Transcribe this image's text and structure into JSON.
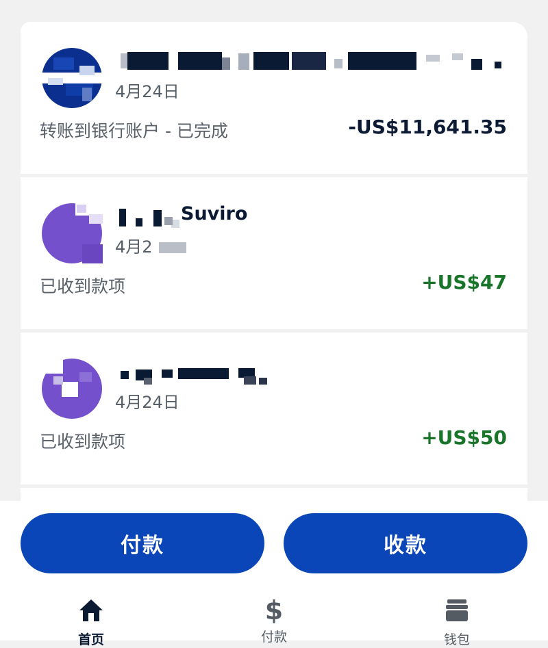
{
  "transactions": [
    {
      "date": "4月24日",
      "description": "转账到银行账户 - 已完成",
      "amount": "-US$11,641.35",
      "avatar": "blue pixelated avatar"
    },
    {
      "name_visible": "Suviro",
      "date": "4月2",
      "description": "已收到款项",
      "amount": "+US$47",
      "avatar": "purple avatar"
    },
    {
      "date": "4月24日",
      "description": "已收到款项",
      "amount": "+US$50",
      "avatar": "purple avatar"
    }
  ],
  "actions": {
    "pay_label": "付款",
    "receive_label": "收款"
  },
  "tabbar": {
    "items": [
      {
        "label": "首页",
        "icon": "home-icon"
      },
      {
        "label": "付款",
        "icon": "dollar-icon"
      },
      {
        "label": "钱包",
        "icon": "wallet-icon"
      }
    ]
  },
  "colors": {
    "primary": "#0a46b8",
    "positive": "#19752a",
    "negative": "#0c1a33",
    "purple_avatar": "#7550cc",
    "blue_avatar": "#0b2f8f"
  }
}
